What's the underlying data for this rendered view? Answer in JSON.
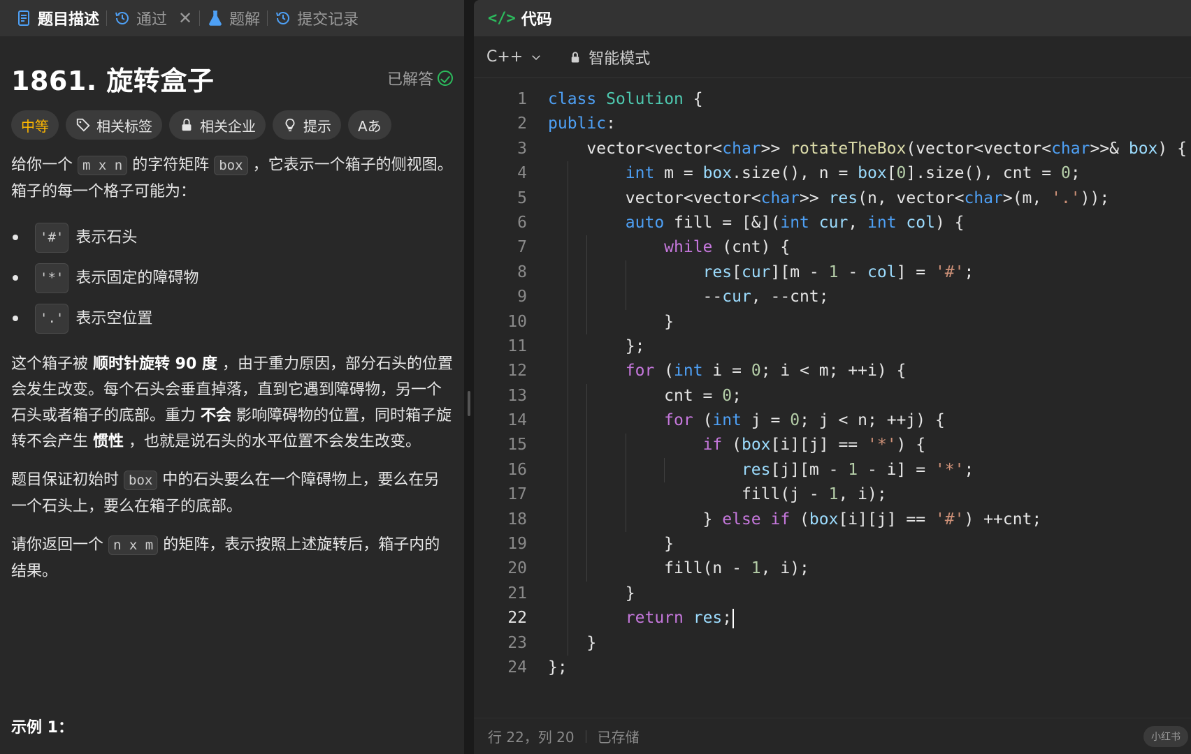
{
  "tabs": [
    {
      "label": "题目描述",
      "icon": "document-icon",
      "active": true
    },
    {
      "label": "通过",
      "icon": "history-icon",
      "closable": true
    },
    {
      "label": "题解",
      "icon": "flask-icon"
    },
    {
      "label": "提交记录",
      "icon": "history-icon"
    }
  ],
  "problem": {
    "title": "1861. 旋转盒子",
    "status": "已解答",
    "chips": {
      "difficulty": "中等",
      "tags": "相关标签",
      "companies": "相关企业",
      "hint": "提示",
      "translate": "Aあ"
    },
    "desc": {
      "p1_a": "给你一个",
      "p1_code1": "m x n",
      "p1_b": "的字符矩阵",
      "p1_code2": "box",
      "p1_c": "，它表示一个箱子的侧视图。箱子的每一个格子可能为：",
      "items": [
        {
          "code": "'#'",
          "text": "表示石头"
        },
        {
          "code": "'*'",
          "text": "表示固定的障碍物"
        },
        {
          "code": "'.'",
          "text": "表示空位置"
        }
      ],
      "p2_a": "这个箱子被",
      "p2_b1": "顺时针旋转 90 度",
      "p2_c": "，由于重力原因，部分石头的位置会发生改变。每个石头会垂直掉落，直到它遇到障碍物，另一个石头或者箱子的底部。重力",
      "p2_b2": "不会",
      "p2_d": "影响障碍物的位置，同时箱子旋转不会产生",
      "p2_b3": "惯性",
      "p2_e": "，也就是说石头的水平位置不会发生改变。",
      "p3_a": "题目保证初始时",
      "p3_code": "box",
      "p3_b": "中的石头要么在一个障碍物上，要么在另一个石头上，要么在箱子的底部。",
      "p4_a": "请你返回一个",
      "p4_code": "n x m",
      "p4_b": "的矩阵，表示按照上述旋转后，箱子内的结果。",
      "example": "示例 1："
    }
  },
  "editor": {
    "header": "代码",
    "language": "C++",
    "mode": "智能模式",
    "current_line": 22,
    "status_pos": "行 22，列 20",
    "status_saved": "已存储",
    "badge": "小红书"
  },
  "code_lines": [
    "class Solution {",
    "public:",
    "    vector<vector<char>> rotateTheBox(vector<vector<char>>& box) {",
    "        int m = box.size(), n = box[0].size(), cnt = 0;",
    "        vector<vector<char>> res(n, vector<char>(m, '.'));",
    "        auto fill = [&](int cur, int col) {",
    "            while (cnt) {",
    "                res[cur][m - 1 - col] = '#';",
    "                --cur, --cnt;",
    "            }",
    "        };",
    "        for (int i = 0; i < m; ++i) {",
    "            cnt = 0;",
    "            for (int j = 0; j < n; ++j) {",
    "                if (box[i][j] == '*') {",
    "                    res[j][m - 1 - i] = '*';",
    "                    fill(j - 1, i);",
    "                } else if (box[i][j] == '#') ++cnt;",
    "            }",
    "            fill(n - 1, i);",
    "        }",
    "        return res;",
    "    }",
    "};"
  ]
}
